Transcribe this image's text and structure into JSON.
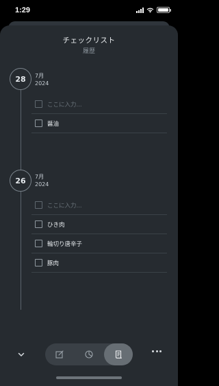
{
  "status_bar": {
    "time": "1:29"
  },
  "header": {
    "title": "チェックリスト",
    "subtitle": "履歴"
  },
  "groups": [
    {
      "day": "28",
      "month": "7月",
      "year": "2024",
      "placeholder": "ここに入力...",
      "items": [
        "醤油"
      ]
    },
    {
      "day": "26",
      "month": "7月",
      "year": "2024",
      "placeholder": "ここに入力...",
      "items": [
        "ひき肉",
        "輪切り唐辛子",
        "豚肉"
      ]
    }
  ],
  "toolbar": {
    "tabs": [
      {
        "icon": "edit-icon",
        "active": false
      },
      {
        "icon": "pie-chart-icon",
        "active": false
      },
      {
        "icon": "history-scroll-icon",
        "active": true
      }
    ]
  },
  "colors": {
    "background": "#262b30",
    "accent_active_tab": "#676e74"
  }
}
